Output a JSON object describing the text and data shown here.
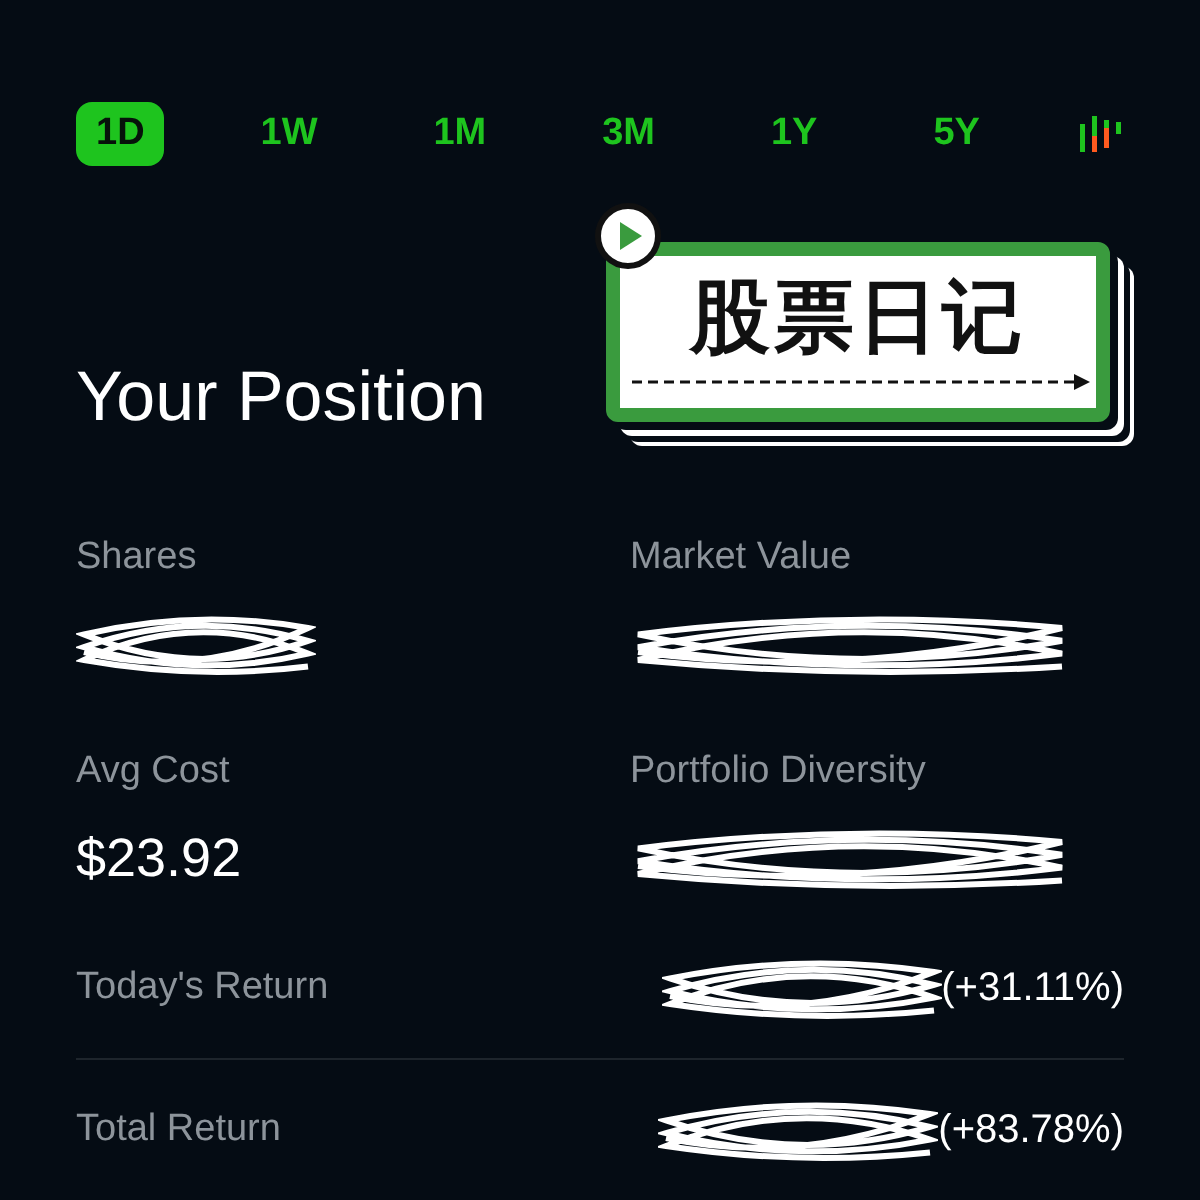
{
  "ranges": [
    {
      "label": "1D",
      "selected": true
    },
    {
      "label": "1W",
      "selected": false
    },
    {
      "label": "1M",
      "selected": false
    },
    {
      "label": "3M",
      "selected": false
    },
    {
      "label": "1Y",
      "selected": false
    },
    {
      "label": "5Y",
      "selected": false
    }
  ],
  "sticker": {
    "text": "股票日记"
  },
  "title": "Your Position",
  "stats": [
    {
      "label": "Shares",
      "redacted": true
    },
    {
      "label": "Market Value",
      "redacted": true
    },
    {
      "label": "Avg Cost",
      "value": "$23.92",
      "redacted": false
    },
    {
      "label": "Portfolio Diversity",
      "redacted": true
    }
  ],
  "returns": [
    {
      "label": "Today's Return",
      "redacted": true,
      "percent": "(+31.11%)"
    },
    {
      "label": "Total Return",
      "redacted": true,
      "percent": "(+83.78%)"
    }
  ]
}
